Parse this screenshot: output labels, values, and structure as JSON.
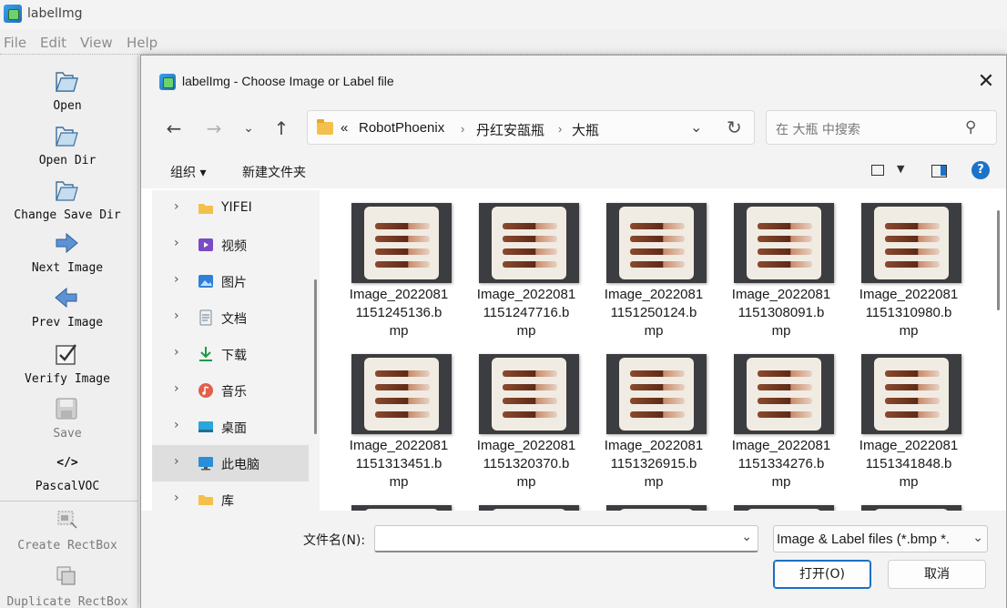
{
  "app": {
    "title": "labelImg"
  },
  "menu": [
    "File",
    "Edit",
    "View",
    "Help"
  ],
  "toolbar": {
    "open": "Open",
    "open_dir": "Open Dir",
    "change_save_dir": "Change Save Dir",
    "next_image": "Next Image",
    "prev_image": "Prev Image",
    "verify_image": "Verify Image",
    "save": "Save",
    "format_icon_text": "</>",
    "format": "PascalVOC",
    "create_rectbox": "Create RectBox",
    "duplicate_rectbox": "Duplicate RectBox"
  },
  "dialog": {
    "title": "labelImg - Choose Image or Label file",
    "close": "✕",
    "breadcrumb": {
      "overflow": "«",
      "items": [
        "RobotPhoenix",
        "丹红安瓿瓶",
        "大瓶"
      ]
    },
    "search_placeholder": "在 大瓶 中搜索",
    "commands": {
      "organize": "组织 ▾",
      "new_folder": "新建文件夹"
    },
    "help": "?",
    "nav_items": [
      {
        "label": "YIFEI",
        "icon": "folder-icon"
      },
      {
        "label": "视频",
        "icon": "video-icon"
      },
      {
        "label": "图片",
        "icon": "picture-icon"
      },
      {
        "label": "文档",
        "icon": "document-icon"
      },
      {
        "label": "下载",
        "icon": "download-icon"
      },
      {
        "label": "音乐",
        "icon": "music-icon"
      },
      {
        "label": "桌面",
        "icon": "desktop-icon"
      },
      {
        "label": "此电脑",
        "icon": "computer-icon",
        "selected": true
      },
      {
        "label": "库",
        "icon": "library-icon"
      }
    ],
    "files": [
      [
        "Image_2022081",
        "1151245136.b",
        "mp"
      ],
      [
        "Image_2022081",
        "1151247716.b",
        "mp"
      ],
      [
        "Image_2022081",
        "1151250124.b",
        "mp"
      ],
      [
        "Image_2022081",
        "1151308091.b",
        "mp"
      ],
      [
        "Image_2022081",
        "1151310980.b",
        "mp"
      ],
      [
        "Image_2022081",
        "1151313451.b",
        "mp"
      ],
      [
        "Image_2022081",
        "1151320370.b",
        "mp"
      ],
      [
        "Image_2022081",
        "1151326915.b",
        "mp"
      ],
      [
        "Image_2022081",
        "1151334276.b",
        "mp"
      ],
      [
        "Image_2022081",
        "1151341848.b",
        "mp"
      ]
    ],
    "filename_label": "文件名(N):",
    "filename_value": "",
    "filter_value": "Image & Label files (*.bmp *.",
    "open_button": "打开(O)",
    "cancel_button": "取消"
  }
}
